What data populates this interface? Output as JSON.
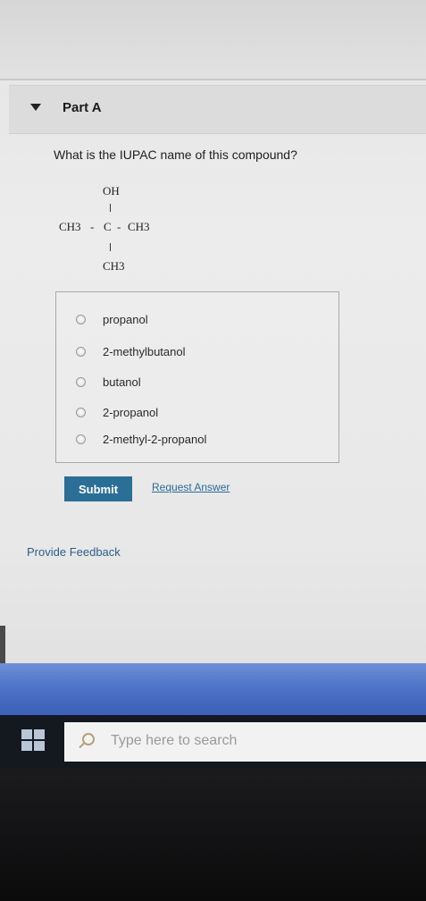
{
  "part": {
    "title": "Part A"
  },
  "question": {
    "text": "What is the IUPAC name of this compound?"
  },
  "structure": {
    "top": "OH",
    "left": "CH3",
    "center": "C",
    "right": "CH3",
    "bottom": "CH3",
    "dash": "-"
  },
  "options": [
    {
      "label": "propanol"
    },
    {
      "label": "2-methylbutanol"
    },
    {
      "label": "butanol"
    },
    {
      "label": "2-propanol"
    },
    {
      "label": "2-methyl-2-propanol"
    }
  ],
  "actions": {
    "submit_label": "Submit",
    "request_label": "Request Answer",
    "feedback_label": "Provide Feedback"
  },
  "taskbar": {
    "search_placeholder": "Type here to search",
    "start_icon": "windows-icon",
    "search_icon": "search-icon"
  },
  "colors": {
    "submit_bg": "#2b6f96",
    "link": "#2a6b9a",
    "taskbar_bg": "#14181f"
  }
}
